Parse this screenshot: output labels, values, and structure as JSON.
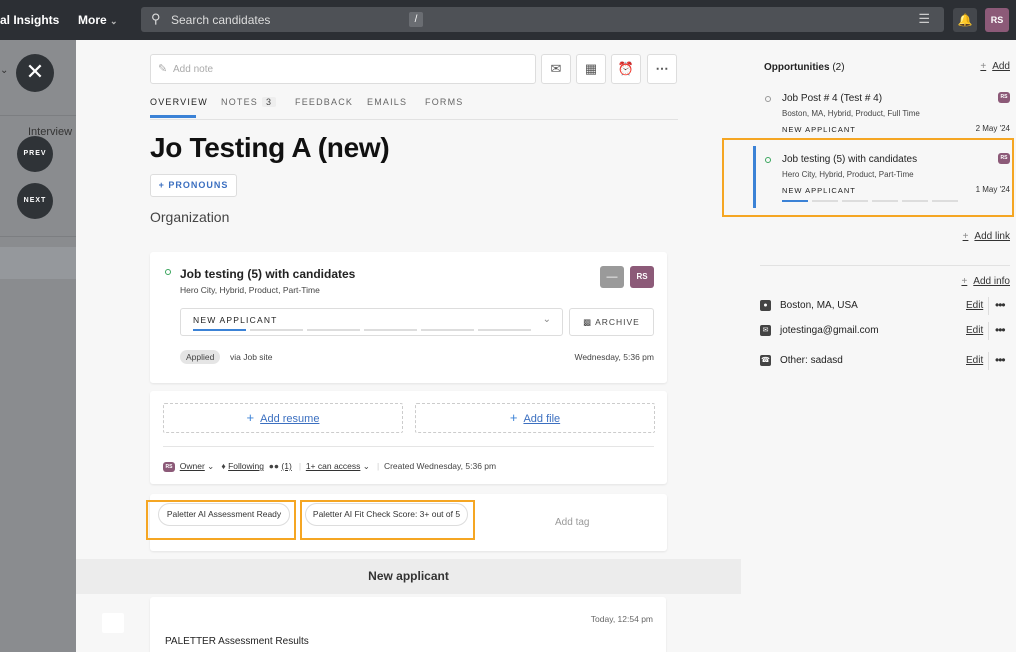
{
  "topbar": {
    "brand": "al Insights",
    "more": "More",
    "search_placeholder": "Search candidates",
    "search_shortcut": "/",
    "avatar": "RS"
  },
  "leftpane": {
    "interview_label": "Interview",
    "prev": "PREV",
    "next": "NEXT"
  },
  "note": {
    "placeholder": "Add note"
  },
  "tabs": [
    {
      "label": "OVERVIEW"
    },
    {
      "label": "NOTES",
      "badge": "3"
    },
    {
      "label": "FEEDBACK"
    },
    {
      "label": "EMAILS"
    },
    {
      "label": "FORMS"
    }
  ],
  "candidate": {
    "name": "Jo Testing A (new)",
    "pronouns_button": "+ PRONOUNS",
    "organization": "Organization"
  },
  "opportunity_card": {
    "title": "Job testing (5) with candidates",
    "subtitle": "Hero City, Hybrid, Product, Part-Time",
    "grey_button": "—",
    "avatar": "RS",
    "stage": "NEW APPLICANT",
    "stage_progress": 1,
    "stage_segments": 6,
    "archive": "ARCHIVE",
    "status_pill": "Applied",
    "via": "via Job site",
    "timestamp": "Wednesday, 5:36 pm"
  },
  "files": {
    "add_resume": "Add resume",
    "add_file": "Add file",
    "owner_avatar": "RS",
    "owner": "Owner",
    "following": "Following",
    "followers": "(1)",
    "access": "1+ can access",
    "created": "Created Wednesday, 5:36 pm"
  },
  "tags": {
    "tag1": "Paletter AI Assessment Ready",
    "tag2": "Paletter AI Fit Check Score: 3+ out of 5",
    "add_tag": "Add tag"
  },
  "section": {
    "title": "New applicant"
  },
  "bottom_card": {
    "timestamp": "Today, 12:54 pm",
    "heading": "PALETTER Assessment Results"
  },
  "opportunities": {
    "title": "Opportunities",
    "count": "(2)",
    "add": "Add",
    "items": [
      {
        "title": "Job Post # 4 (Test # 4)",
        "subtitle": "Boston, MA, Hybrid, Product, Full Time",
        "stage": "NEW APPLICANT",
        "date": "2 May '24",
        "avatar": "RS"
      },
      {
        "title": "Job testing (5) with candidates",
        "subtitle": "Hero City, Hybrid, Product, Part-Time",
        "stage": "NEW APPLICANT",
        "date": "1 May '24",
        "avatar": "RS",
        "stage_progress": 1,
        "stage_segments": 6
      }
    ],
    "add_link": "Add link"
  },
  "contact": {
    "add_info": "Add info",
    "items": [
      {
        "icon": "location-icon",
        "value": "Boston, MA, USA",
        "edit": "Edit"
      },
      {
        "icon": "email-icon",
        "value": "jotestinga@gmail.com",
        "edit": "Edit"
      },
      {
        "icon": "phone-icon",
        "value": "Other: sadasd",
        "edit": "Edit"
      }
    ]
  },
  "colors": {
    "accent": "#3b82d6",
    "highlight": "#f5a623",
    "avatar": "#8c5a78",
    "topbar": "#2c2f34"
  }
}
